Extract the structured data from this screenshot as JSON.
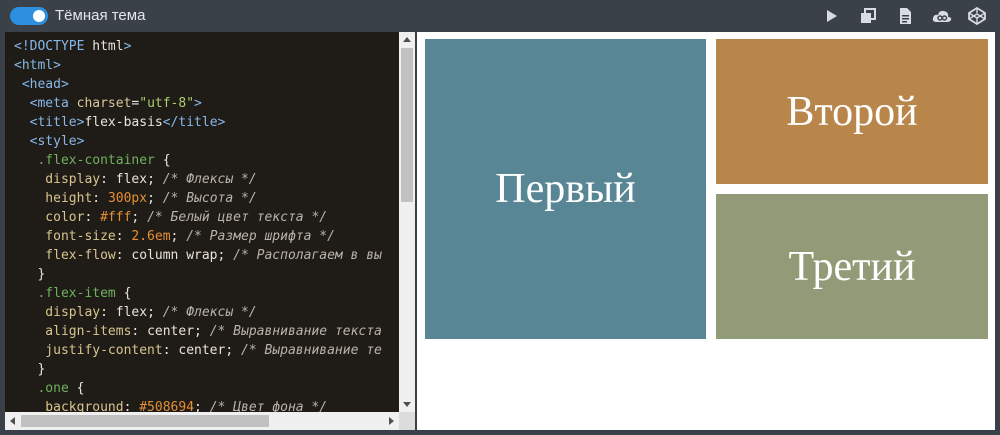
{
  "topbar": {
    "theme_label": "Тёмная тема",
    "toggle_on": true,
    "accent": "#2d8fe0",
    "icons": [
      "play-icon",
      "new-window-icon",
      "document-icon",
      "cloud-icon",
      "codepen-icon"
    ]
  },
  "editor": {
    "lines": [
      [
        {
          "c": "tg",
          "t": "<!DOCTYPE "
        },
        {
          "c": "tx",
          "t": "html"
        },
        {
          "c": "tg",
          "t": ">"
        }
      ],
      [
        {
          "c": "tg",
          "t": "<html>"
        }
      ],
      [
        {
          "c": "tg",
          "t": " <head>"
        }
      ],
      [
        {
          "c": "tg",
          "t": "  <meta "
        },
        {
          "c": "at",
          "t": "charset"
        },
        {
          "c": "tx",
          "t": "="
        },
        {
          "c": "st",
          "t": "\"utf-8\""
        },
        {
          "c": "tg",
          "t": ">"
        }
      ],
      [
        {
          "c": "tg",
          "t": "  <title>"
        },
        {
          "c": "tx",
          "t": "flex-basis"
        },
        {
          "c": "tg",
          "t": "</title>"
        }
      ],
      [
        {
          "c": "tg",
          "t": "  <style>"
        }
      ],
      [
        {
          "c": "sel",
          "t": "   .flex-container"
        },
        {
          "c": "tx",
          "t": " {"
        }
      ],
      [
        {
          "c": "pr",
          "t": "    display"
        },
        {
          "c": "tx",
          "t": ": "
        },
        {
          "c": "val",
          "t": "flex"
        },
        {
          "c": "tx",
          "t": "; "
        },
        {
          "c": "cm",
          "t": "/* Флексы */"
        }
      ],
      [
        {
          "c": "pr",
          "t": "    height"
        },
        {
          "c": "tx",
          "t": ": "
        },
        {
          "c": "num",
          "t": "300px"
        },
        {
          "c": "tx",
          "t": "; "
        },
        {
          "c": "cm",
          "t": "/* Высота */"
        }
      ],
      [
        {
          "c": "pr",
          "t": "    color"
        },
        {
          "c": "tx",
          "t": ": "
        },
        {
          "c": "num",
          "t": "#fff"
        },
        {
          "c": "tx",
          "t": "; "
        },
        {
          "c": "cm",
          "t": "/* Белый цвет текста */"
        }
      ],
      [
        {
          "c": "pr",
          "t": "    font-size"
        },
        {
          "c": "tx",
          "t": ": "
        },
        {
          "c": "num",
          "t": "2.6em"
        },
        {
          "c": "tx",
          "t": "; "
        },
        {
          "c": "cm",
          "t": "/* Размер шрифта */"
        }
      ],
      [
        {
          "c": "pr",
          "t": "    flex-flow"
        },
        {
          "c": "tx",
          "t": ": "
        },
        {
          "c": "val",
          "t": "column wrap"
        },
        {
          "c": "tx",
          "t": "; "
        },
        {
          "c": "cm",
          "t": "/* Располагаем в вы"
        }
      ],
      [
        {
          "c": "tx",
          "t": "   }"
        }
      ],
      [
        {
          "c": "sel",
          "t": "   .flex-item"
        },
        {
          "c": "tx",
          "t": " {"
        }
      ],
      [
        {
          "c": "pr",
          "t": "    display"
        },
        {
          "c": "tx",
          "t": ": "
        },
        {
          "c": "val",
          "t": "flex"
        },
        {
          "c": "tx",
          "t": "; "
        },
        {
          "c": "cm",
          "t": "/* Флексы */"
        }
      ],
      [
        {
          "c": "pr",
          "t": "    align-items"
        },
        {
          "c": "tx",
          "t": ": "
        },
        {
          "c": "val",
          "t": "center"
        },
        {
          "c": "tx",
          "t": "; "
        },
        {
          "c": "cm",
          "t": "/* Выравнивание текста"
        }
      ],
      [
        {
          "c": "pr",
          "t": "    justify-content"
        },
        {
          "c": "tx",
          "t": ": "
        },
        {
          "c": "val",
          "t": "center"
        },
        {
          "c": "tx",
          "t": "; "
        },
        {
          "c": "cm",
          "t": "/* Выравнивание те"
        }
      ],
      [
        {
          "c": "tx",
          "t": "   }"
        }
      ],
      [
        {
          "c": "sel",
          "t": "   .one"
        },
        {
          "c": "tx",
          "t": " {"
        }
      ],
      [
        {
          "c": "pr",
          "t": "    background"
        },
        {
          "c": "tx",
          "t": ": "
        },
        {
          "c": "num",
          "t": "#508694"
        },
        {
          "c": "tx",
          "t": "; "
        },
        {
          "c": "cm",
          "t": "/* Цвет фона */"
        }
      ]
    ]
  },
  "preview": {
    "items": [
      {
        "label": "Первый",
        "color": "#588694"
      },
      {
        "label": "Второй",
        "color": "#b8854a"
      },
      {
        "label": "Третий",
        "color": "#919b78"
      }
    ]
  }
}
